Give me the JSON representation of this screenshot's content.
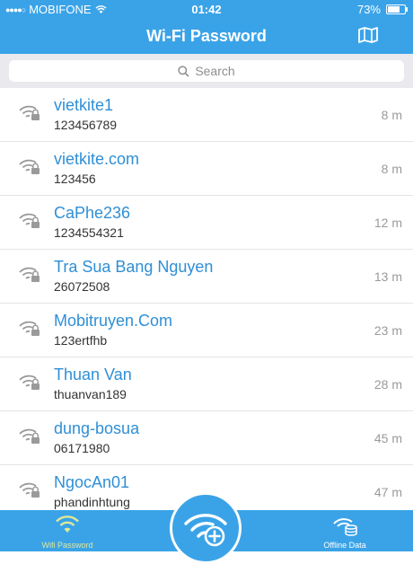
{
  "status_bar": {
    "carrier": "MOBIFONE",
    "time": "01:42",
    "battery_percent": "73%",
    "battery_level": 0.73
  },
  "header": {
    "title": "Wi-Fi Password",
    "map_icon": "map-icon"
  },
  "search": {
    "placeholder": "Search"
  },
  "networks": [
    {
      "name": "vietkite1",
      "password": "123456789",
      "distance": "8 m"
    },
    {
      "name": "vietkite.com",
      "password": "123456",
      "distance": "8 m"
    },
    {
      "name": "CaPhe236",
      "password": "1234554321",
      "distance": "12 m"
    },
    {
      "name": "Tra Sua Bang Nguyen",
      "password": "26072508",
      "distance": "13 m"
    },
    {
      "name": "Mobitruyen.Com",
      "password": "123ertfhb",
      "distance": "23 m"
    },
    {
      "name": "Thuan Van",
      "password": "thuanvan189",
      "distance": "28 m"
    },
    {
      "name": "dung-bosua",
      "password": "06171980",
      "distance": "45 m"
    },
    {
      "name": "NgocAn01",
      "password": "phandinhtung",
      "distance": "47 m"
    }
  ],
  "tabbar": {
    "wifi_label": "Wifi Password",
    "offline_label": "Offline Data"
  },
  "colors": {
    "accent": "#3aa3e8",
    "network_name": "#2f8fd6",
    "active_tab": "#e0e89a"
  }
}
